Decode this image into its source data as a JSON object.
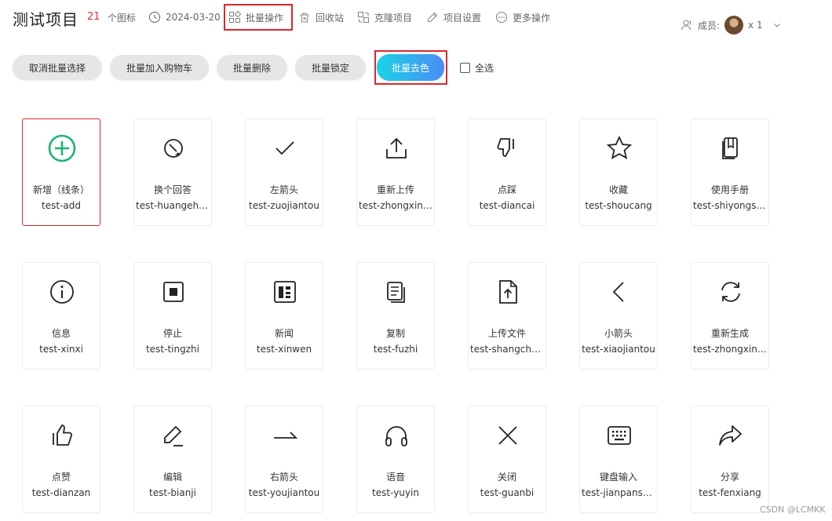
{
  "header": {
    "title": "测试项目",
    "icon_count": "21",
    "icon_count_label": "个图标",
    "date": "2024-03-20",
    "batch_ops": "批量操作",
    "recycle": "回收站",
    "clone": "克隆项目",
    "settings": "项目设置",
    "more": "更多操作",
    "members_label": "成员:",
    "members_count": "x 1"
  },
  "toolbar": {
    "cancel": "取消批量选择",
    "add_cart": "批量加入购物车",
    "delete": "批量删除",
    "lock": "批量锁定",
    "decolor": "批量去色",
    "select_all": "全选"
  },
  "icons": [
    {
      "name": "新增（线条）",
      "code": "test-add",
      "icon": "add-circle-icon",
      "selected": true
    },
    {
      "name": "换个回答",
      "code": "test-huangehuida",
      "icon": "refresh-answer-icon"
    },
    {
      "name": "左箭头",
      "code": "test-zuojiantou",
      "icon": "check-icon"
    },
    {
      "name": "重新上传",
      "code": "test-zhongxinshangchuan",
      "icon": "upload-icon"
    },
    {
      "name": "点踩",
      "code": "test-diancai",
      "icon": "thumbs-down-icon"
    },
    {
      "name": "收藏",
      "code": "test-shoucang",
      "icon": "star-icon"
    },
    {
      "name": "使用手册",
      "code": "test-shiyongshouce",
      "icon": "manual-icon"
    },
    {
      "name": "信息",
      "code": "test-xinxi",
      "icon": "info-icon"
    },
    {
      "name": "停止",
      "code": "test-tingzhi",
      "icon": "stop-icon"
    },
    {
      "name": "新闻",
      "code": "test-xinwen",
      "icon": "news-icon"
    },
    {
      "name": "复制",
      "code": "test-fuzhi",
      "icon": "copy-icon"
    },
    {
      "name": "上传文件",
      "code": "test-shangchuanwenjian",
      "icon": "upload-file-icon"
    },
    {
      "name": "小箭头",
      "code": "test-xiaojiantou",
      "icon": "chevron-left-icon"
    },
    {
      "name": "重新生成",
      "code": "test-zhongxinshengcheng",
      "icon": "regenerate-icon"
    },
    {
      "name": "点赞",
      "code": "test-dianzan",
      "icon": "thumbs-up-icon"
    },
    {
      "name": "编辑",
      "code": "test-bianji",
      "icon": "edit-icon"
    },
    {
      "name": "右箭头",
      "code": "test-youjiantou",
      "icon": "arrow-right-icon"
    },
    {
      "name": "语音",
      "code": "test-yuyin",
      "icon": "headphones-icon"
    },
    {
      "name": "关闭",
      "code": "test-guanbi",
      "icon": "close-icon"
    },
    {
      "name": "键盘输入",
      "code": "test-jianpanshuru",
      "icon": "keyboard-icon"
    },
    {
      "name": "分享",
      "code": "test-fenxiang",
      "icon": "share-icon"
    }
  ],
  "colors": {
    "accent_green": "#1bb56f",
    "highlight_red": "#d9292d",
    "count_red": "#e03030",
    "grad_start": "#19d3e6",
    "grad_end": "#4c8cf5"
  },
  "watermark": "CSDN @LCMKK"
}
